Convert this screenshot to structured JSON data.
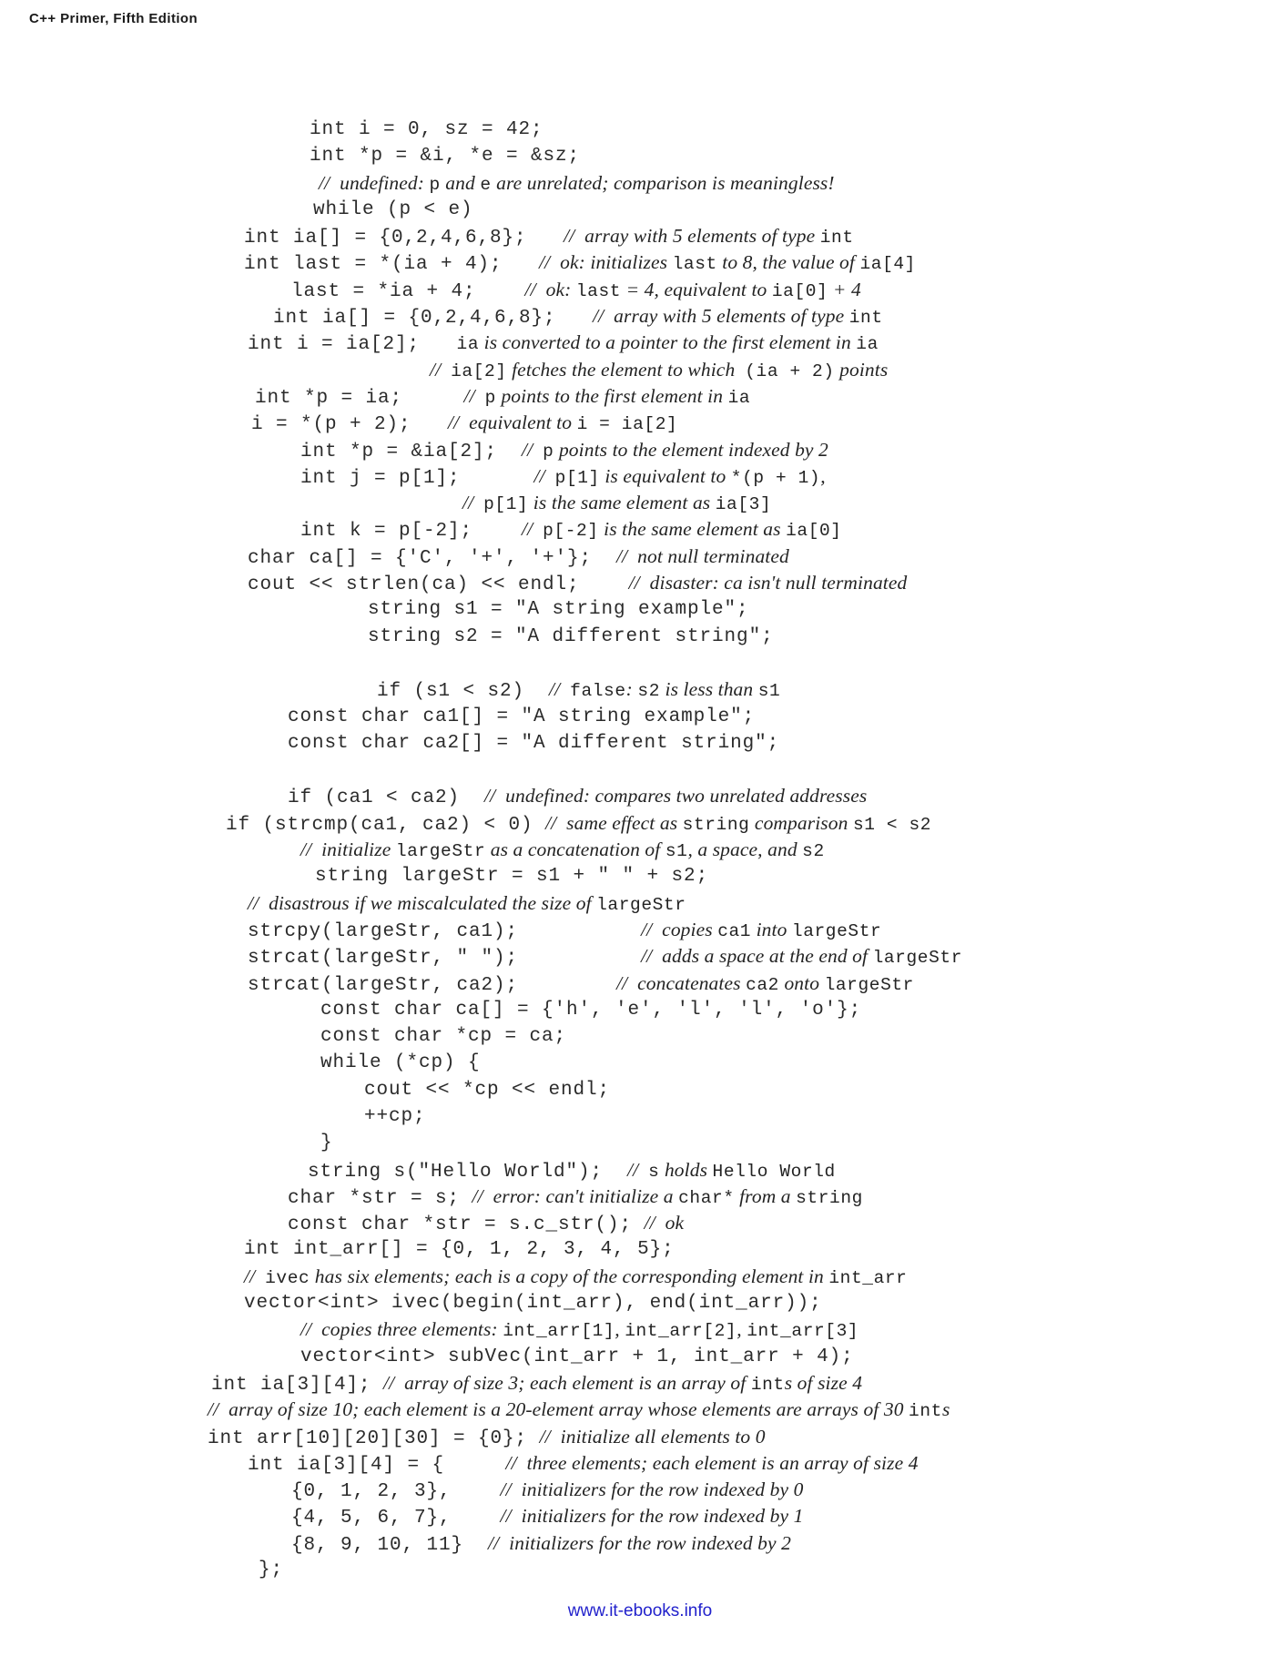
{
  "running_head": "C++ Primer, Fifth Edition",
  "footer": {
    "link_text": "www.it-ebooks.info",
    "color": "#2222cc"
  },
  "code_listing": {
    "lines": [
      {
        "indent": 340,
        "segments": [
          {
            "type": "code",
            "text": "int i = 0, sz = 42;"
          }
        ]
      },
      {
        "indent": 340,
        "segments": [
          {
            "type": "code",
            "text": "int *p = &i, *e = &sz;"
          }
        ]
      },
      {
        "indent": 350,
        "segments": [
          {
            "type": "comment",
            "text": "//  undefined: "
          },
          {
            "type": "comment-code",
            "text": "p"
          },
          {
            "type": "comment",
            "text": " and "
          },
          {
            "type": "comment-code",
            "text": "e"
          },
          {
            "type": "comment",
            "text": " are unrelated; comparison is meaningless!"
          }
        ]
      },
      {
        "indent": 344,
        "segments": [
          {
            "type": "code",
            "text": "while (p < e)"
          }
        ]
      },
      {
        "indent": 268,
        "segments": [
          {
            "type": "code",
            "text": "int ia[] = {0,2,4,6,8};   "
          },
          {
            "type": "comment",
            "text": "//  array with 5 elements of type "
          },
          {
            "type": "comment-code",
            "text": "int"
          }
        ]
      },
      {
        "indent": 268,
        "segments": [
          {
            "type": "code",
            "text": "int last = *(ia + 4);   "
          },
          {
            "type": "comment",
            "text": "//  ok: initializes "
          },
          {
            "type": "comment-code",
            "text": "last"
          },
          {
            "type": "comment",
            "text": " to 8, the value of "
          },
          {
            "type": "comment-code",
            "text": "ia[4]"
          }
        ]
      },
      {
        "indent": 320,
        "segments": [
          {
            "type": "code",
            "text": "last = *ia + 4;    "
          },
          {
            "type": "comment",
            "text": "//  ok: "
          },
          {
            "type": "comment-code",
            "text": "last"
          },
          {
            "type": "comment",
            "text": " = 4, equivalent to "
          },
          {
            "type": "comment-code",
            "text": "ia[0]"
          },
          {
            "type": "comment",
            "text": " + 4"
          }
        ]
      },
      {
        "indent": 300,
        "segments": [
          {
            "type": "code",
            "text": "int ia[] = {0,2,4,6,8};   "
          },
          {
            "type": "comment",
            "text": "//  array with 5 elements of type "
          },
          {
            "type": "comment-code",
            "text": "int"
          }
        ]
      },
      {
        "indent": 272,
        "segments": [
          {
            "type": "code",
            "text": "int i = ia[2];   "
          },
          {
            "type": "comment-code",
            "text": "ia"
          },
          {
            "type": "comment",
            "text": " is converted to a pointer to the first element in "
          },
          {
            "type": "comment-code",
            "text": "ia"
          }
        ]
      },
      {
        "indent": 472,
        "segments": [
          {
            "type": "comment",
            "text": "//  "
          },
          {
            "type": "comment-code",
            "text": "ia[2]"
          },
          {
            "type": "comment",
            "text": " fetches the element to which  "
          },
          {
            "type": "comment-code",
            "text": "(ia + 2)"
          },
          {
            "type": "comment",
            "text": " points"
          }
        ]
      },
      {
        "indent": 280,
        "segments": [
          {
            "type": "code",
            "text": "int *p = ia;     "
          },
          {
            "type": "comment",
            "text": "//  "
          },
          {
            "type": "comment-code",
            "text": "p"
          },
          {
            "type": "comment",
            "text": " points to the first element in "
          },
          {
            "type": "comment-code",
            "text": "ia"
          }
        ]
      },
      {
        "indent": 276,
        "segments": [
          {
            "type": "code",
            "text": "i = *(p + 2);   "
          },
          {
            "type": "comment",
            "text": "//  equivalent to "
          },
          {
            "type": "comment-code",
            "text": "i = ia[2]"
          }
        ]
      },
      {
        "indent": 330,
        "segments": [
          {
            "type": "code",
            "text": "int *p = &ia[2];  "
          },
          {
            "type": "comment",
            "text": "//  "
          },
          {
            "type": "comment-code",
            "text": "p"
          },
          {
            "type": "comment",
            "text": " points to the element indexed by 2"
          }
        ]
      },
      {
        "indent": 330,
        "segments": [
          {
            "type": "code",
            "text": "int j = p[1];      "
          },
          {
            "type": "comment",
            "text": "//  "
          },
          {
            "type": "comment-code",
            "text": "p[1]"
          },
          {
            "type": "comment",
            "text": " is equivalent to "
          },
          {
            "type": "comment-code",
            "text": "*(p + 1)"
          },
          {
            "type": "comment",
            "text": ","
          }
        ]
      },
      {
        "indent": 508,
        "segments": [
          {
            "type": "comment",
            "text": "//  "
          },
          {
            "type": "comment-code",
            "text": "p[1]"
          },
          {
            "type": "comment",
            "text": " is the same element as "
          },
          {
            "type": "comment-code",
            "text": "ia[3]"
          }
        ]
      },
      {
        "indent": 330,
        "segments": [
          {
            "type": "code",
            "text": "int k = p[-2];    "
          },
          {
            "type": "comment",
            "text": "//  "
          },
          {
            "type": "comment-code",
            "text": "p[-2]"
          },
          {
            "type": "comment",
            "text": " is the same element as "
          },
          {
            "type": "comment-code",
            "text": "ia[0]"
          }
        ]
      },
      {
        "indent": 272,
        "segments": [
          {
            "type": "code",
            "text": "char ca[] = {'C', '+', '+'};  "
          },
          {
            "type": "comment",
            "text": "//  not null terminated"
          }
        ]
      },
      {
        "indent": 272,
        "segments": [
          {
            "type": "code",
            "text": "cout << strlen(ca) << endl;    "
          },
          {
            "type": "comment",
            "text": "//  disaster: ca isn't null terminated"
          }
        ]
      },
      {
        "indent": 404,
        "segments": [
          {
            "type": "code",
            "text": "string s1 = \"A string example\";"
          }
        ]
      },
      {
        "indent": 404,
        "segments": [
          {
            "type": "code",
            "text": "string s2 = \"A different string\";"
          }
        ]
      },
      {
        "indent": 0,
        "segments": []
      },
      {
        "indent": 414,
        "segments": [
          {
            "type": "code",
            "text": "if (s1 < s2)  "
          },
          {
            "type": "comment",
            "text": "//  "
          },
          {
            "type": "comment-code",
            "text": "false"
          },
          {
            "type": "comment",
            "text": ": "
          },
          {
            "type": "comment-code",
            "text": "s2"
          },
          {
            "type": "comment",
            "text": " is less than "
          },
          {
            "type": "comment-code",
            "text": "s1"
          }
        ]
      },
      {
        "indent": 316,
        "segments": [
          {
            "type": "code",
            "text": "const char ca1[] = \"A string example\";"
          }
        ]
      },
      {
        "indent": 316,
        "segments": [
          {
            "type": "code",
            "text": "const char ca2[] = \"A different string\";"
          }
        ]
      },
      {
        "indent": 0,
        "segments": []
      },
      {
        "indent": 316,
        "segments": [
          {
            "type": "code",
            "text": "if (ca1 < ca2)  "
          },
          {
            "type": "comment",
            "text": "//  undefined: compares two unrelated addresses"
          }
        ]
      },
      {
        "indent": 248,
        "segments": [
          {
            "type": "code",
            "text": "if (strcmp(ca1, ca2) < 0) "
          },
          {
            "type": "comment",
            "text": "//  same effect as "
          },
          {
            "type": "comment-code",
            "text": "string"
          },
          {
            "type": "comment",
            "text": " comparison "
          },
          {
            "type": "comment-code",
            "text": "s1 < s2"
          }
        ]
      },
      {
        "indent": 330,
        "segments": [
          {
            "type": "comment",
            "text": "//  initialize "
          },
          {
            "type": "comment-code",
            "text": "largeStr"
          },
          {
            "type": "comment",
            "text": " as a concatenation of "
          },
          {
            "type": "comment-code",
            "text": "s1"
          },
          {
            "type": "comment",
            "text": ", a space, and "
          },
          {
            "type": "comment-code",
            "text": "s2"
          }
        ]
      },
      {
        "indent": 346,
        "segments": [
          {
            "type": "code",
            "text": "string largeStr = s1 + \" \" + s2;"
          }
        ]
      },
      {
        "indent": 272,
        "segments": [
          {
            "type": "comment",
            "text": "//  disastrous if we miscalculated the size of "
          },
          {
            "type": "comment-code",
            "text": "largeStr"
          }
        ]
      },
      {
        "indent": 272,
        "segments": [
          {
            "type": "code",
            "text": "strcpy(largeStr, ca1);          "
          },
          {
            "type": "comment",
            "text": "//  copies "
          },
          {
            "type": "comment-code",
            "text": "ca1"
          },
          {
            "type": "comment",
            "text": " into "
          },
          {
            "type": "comment-code",
            "text": "largeStr"
          }
        ]
      },
      {
        "indent": 272,
        "segments": [
          {
            "type": "code",
            "text": "strcat(largeStr, \" \");          "
          },
          {
            "type": "comment",
            "text": "//  adds a space at the end of "
          },
          {
            "type": "comment-code",
            "text": "largeStr"
          }
        ]
      },
      {
        "indent": 272,
        "segments": [
          {
            "type": "code",
            "text": "strcat(largeStr, ca2);        "
          },
          {
            "type": "comment",
            "text": "//  concatenates "
          },
          {
            "type": "comment-code",
            "text": "ca2"
          },
          {
            "type": "comment",
            "text": " onto "
          },
          {
            "type": "comment-code",
            "text": "largeStr"
          }
        ]
      },
      {
        "indent": 352,
        "segments": [
          {
            "type": "code",
            "text": "const char ca[] = {'h', 'e', 'l', 'l', 'o'};"
          }
        ]
      },
      {
        "indent": 352,
        "segments": [
          {
            "type": "code",
            "text": "const char *cp = ca;"
          }
        ]
      },
      {
        "indent": 352,
        "segments": [
          {
            "type": "code",
            "text": "while (*cp) {"
          }
        ]
      },
      {
        "indent": 400,
        "segments": [
          {
            "type": "code",
            "text": "cout << *cp << endl;"
          }
        ]
      },
      {
        "indent": 400,
        "segments": [
          {
            "type": "code",
            "text": "++cp;"
          }
        ]
      },
      {
        "indent": 352,
        "segments": [
          {
            "type": "code",
            "text": "}"
          }
        ]
      },
      {
        "indent": 338,
        "segments": [
          {
            "type": "code",
            "text": "string s(\"Hello World\");  "
          },
          {
            "type": "comment",
            "text": "//  "
          },
          {
            "type": "comment-code",
            "text": "s"
          },
          {
            "type": "comment",
            "text": " holds "
          },
          {
            "type": "comment-code",
            "text": "Hello World"
          }
        ]
      },
      {
        "indent": 316,
        "segments": [
          {
            "type": "code",
            "text": "char *str = s; "
          },
          {
            "type": "comment",
            "text": "//  error: can't initialize a "
          },
          {
            "type": "comment-code",
            "text": "char*"
          },
          {
            "type": "comment",
            "text": " from a "
          },
          {
            "type": "comment-code",
            "text": "string"
          }
        ]
      },
      {
        "indent": 316,
        "segments": [
          {
            "type": "code",
            "text": "const char *str = s.c_str(); "
          },
          {
            "type": "comment",
            "text": "//  ok"
          }
        ]
      },
      {
        "indent": 268,
        "segments": [
          {
            "type": "code",
            "text": "int int_arr[] = {0, 1, 2, 3, 4, 5};"
          }
        ]
      },
      {
        "indent": 268,
        "segments": [
          {
            "type": "comment",
            "text": "//  "
          },
          {
            "type": "comment-code",
            "text": "ivec"
          },
          {
            "type": "comment",
            "text": " has six elements; each is a copy of the corresponding element in "
          },
          {
            "type": "comment-code",
            "text": "int_arr"
          }
        ]
      },
      {
        "indent": 268,
        "segments": [
          {
            "type": "code",
            "text": "vector<int> ivec(begin(int_arr), end(int_arr));"
          }
        ]
      },
      {
        "indent": 330,
        "segments": [
          {
            "type": "comment",
            "text": "//  copies three elements: "
          },
          {
            "type": "comment-code",
            "text": "int_arr[1]"
          },
          {
            "type": "comment",
            "text": ", "
          },
          {
            "type": "comment-code",
            "text": "int_arr[2]"
          },
          {
            "type": "comment",
            "text": ", "
          },
          {
            "type": "comment-code",
            "text": "int_arr[3]"
          }
        ]
      },
      {
        "indent": 330,
        "segments": [
          {
            "type": "code",
            "text": "vector<int> subVec(int_arr + 1, int_arr + 4);"
          }
        ]
      },
      {
        "indent": 232,
        "segments": [
          {
            "type": "code",
            "text": "int ia[3][4]; "
          },
          {
            "type": "comment",
            "text": "//  array of size 3; each element is an array of "
          },
          {
            "type": "comment-code",
            "text": "int"
          },
          {
            "type": "comment",
            "text": "s of size 4"
          }
        ]
      },
      {
        "indent": 228,
        "segments": [
          {
            "type": "comment",
            "text": "//  array of size 10; each element is a 20-element array whose elements are arrays of 30 "
          },
          {
            "type": "comment-code",
            "text": "int"
          },
          {
            "type": "comment",
            "text": "s"
          }
        ]
      },
      {
        "indent": 228,
        "segments": [
          {
            "type": "code",
            "text": "int arr[10][20][30] = {0}; "
          },
          {
            "type": "comment",
            "text": "//  initialize all elements to 0"
          }
        ]
      },
      {
        "indent": 272,
        "segments": [
          {
            "type": "code",
            "text": "int ia[3][4] = {     "
          },
          {
            "type": "comment",
            "text": "//  three elements; each element is an array of size 4"
          }
        ]
      },
      {
        "indent": 320,
        "segments": [
          {
            "type": "code",
            "text": "{0, 1, 2, 3},    "
          },
          {
            "type": "comment",
            "text": "//  initializers for the row indexed by 0"
          }
        ]
      },
      {
        "indent": 320,
        "segments": [
          {
            "type": "code",
            "text": "{4, 5, 6, 7},    "
          },
          {
            "type": "comment",
            "text": "//  initializers for the row indexed by 1"
          }
        ]
      },
      {
        "indent": 320,
        "segments": [
          {
            "type": "code",
            "text": "{8, 9, 10, 11}  "
          },
          {
            "type": "comment",
            "text": "//  initializers for the row indexed by 2"
          }
        ]
      },
      {
        "indent": 284,
        "segments": [
          {
            "type": "code",
            "text": "};"
          }
        ]
      }
    ]
  }
}
